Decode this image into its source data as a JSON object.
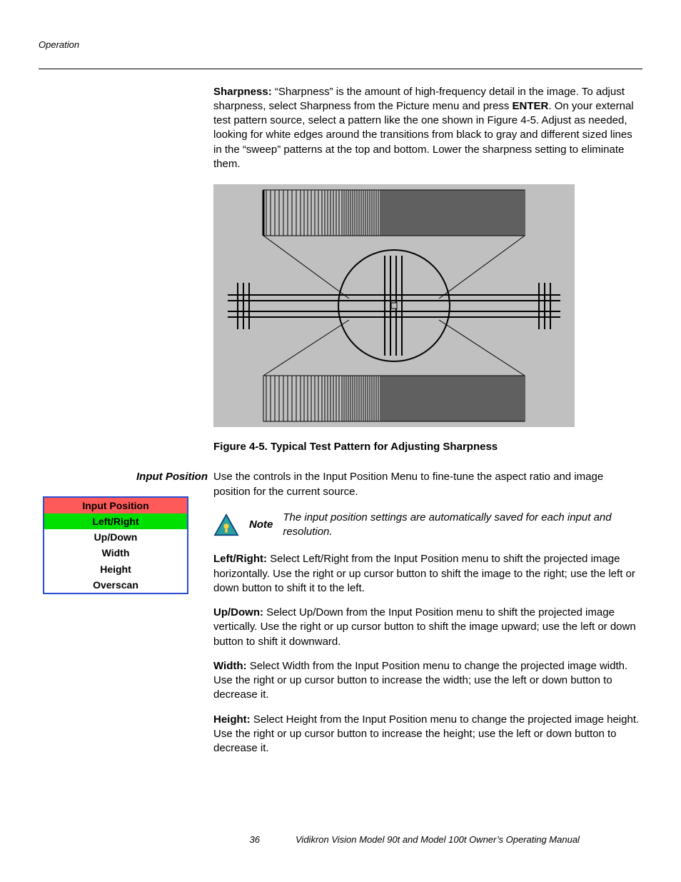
{
  "section_header": "Operation",
  "para_sharpness_pre": "Sharpness: ",
  "para_sharpness_mid1": "“Sharpness” is the amount of high-frequency detail in the image. To adjust sharpness, select Sharpness from the Picture menu and press ",
  "para_sharpness_bold2": "ENTER",
  "para_sharpness_post": ". On your external test pattern source, select a pattern like the one shown in Figure 4-5. Adjust as needed, looking for white edges around the transitions from black to gray and different sized lines in the “sweep” patterns at the top and bottom. Lower the sharpness setting to eliminate them.",
  "figure_caption": "Figure 4-5. Typical Test Pattern for Adjusting Sharpness",
  "side_heading": "Input Position",
  "menu": {
    "title": "Input Position",
    "items": [
      "Left/Right",
      "Up/Down",
      "Width",
      "Height",
      "Overscan"
    ],
    "selected_index": 0
  },
  "para_intro": "Use the controls in the Input Position Menu to fine-tune the aspect ratio and image position for the current source.",
  "note_label": "Note",
  "note_text": "The input position settings are automatically saved for each input and resolution.",
  "para_lr_b": "Left/Right: ",
  "para_lr": "Select Left/Right from the Input Position menu to shift the projected image horizontally. Use the right or up cursor button to shift the image to the right; use the left or down button to shift it to the left.",
  "para_ud_b": "Up/Down: ",
  "para_ud": "Select Up/Down from the Input Position menu to shift the projected image vertically. Use the right or up cursor button to shift the image upward; use the left or down button to shift it downward.",
  "para_w_b": "Width: ",
  "para_w": "Select Width from the Input Position menu to change the projected image width. Use the right or up cursor button to increase the width; use the left or down button to decrease it.",
  "para_h_b": "Height: ",
  "para_h": "Select Height from the Input Position menu to change the projected image height. Use the right or up cursor button to increase the height; use the left or down button to decrease it.",
  "footer_page": "36",
  "footer_doc": "Vidikron Vision Model 90t and Model 100t Owner’s Operating Manual"
}
